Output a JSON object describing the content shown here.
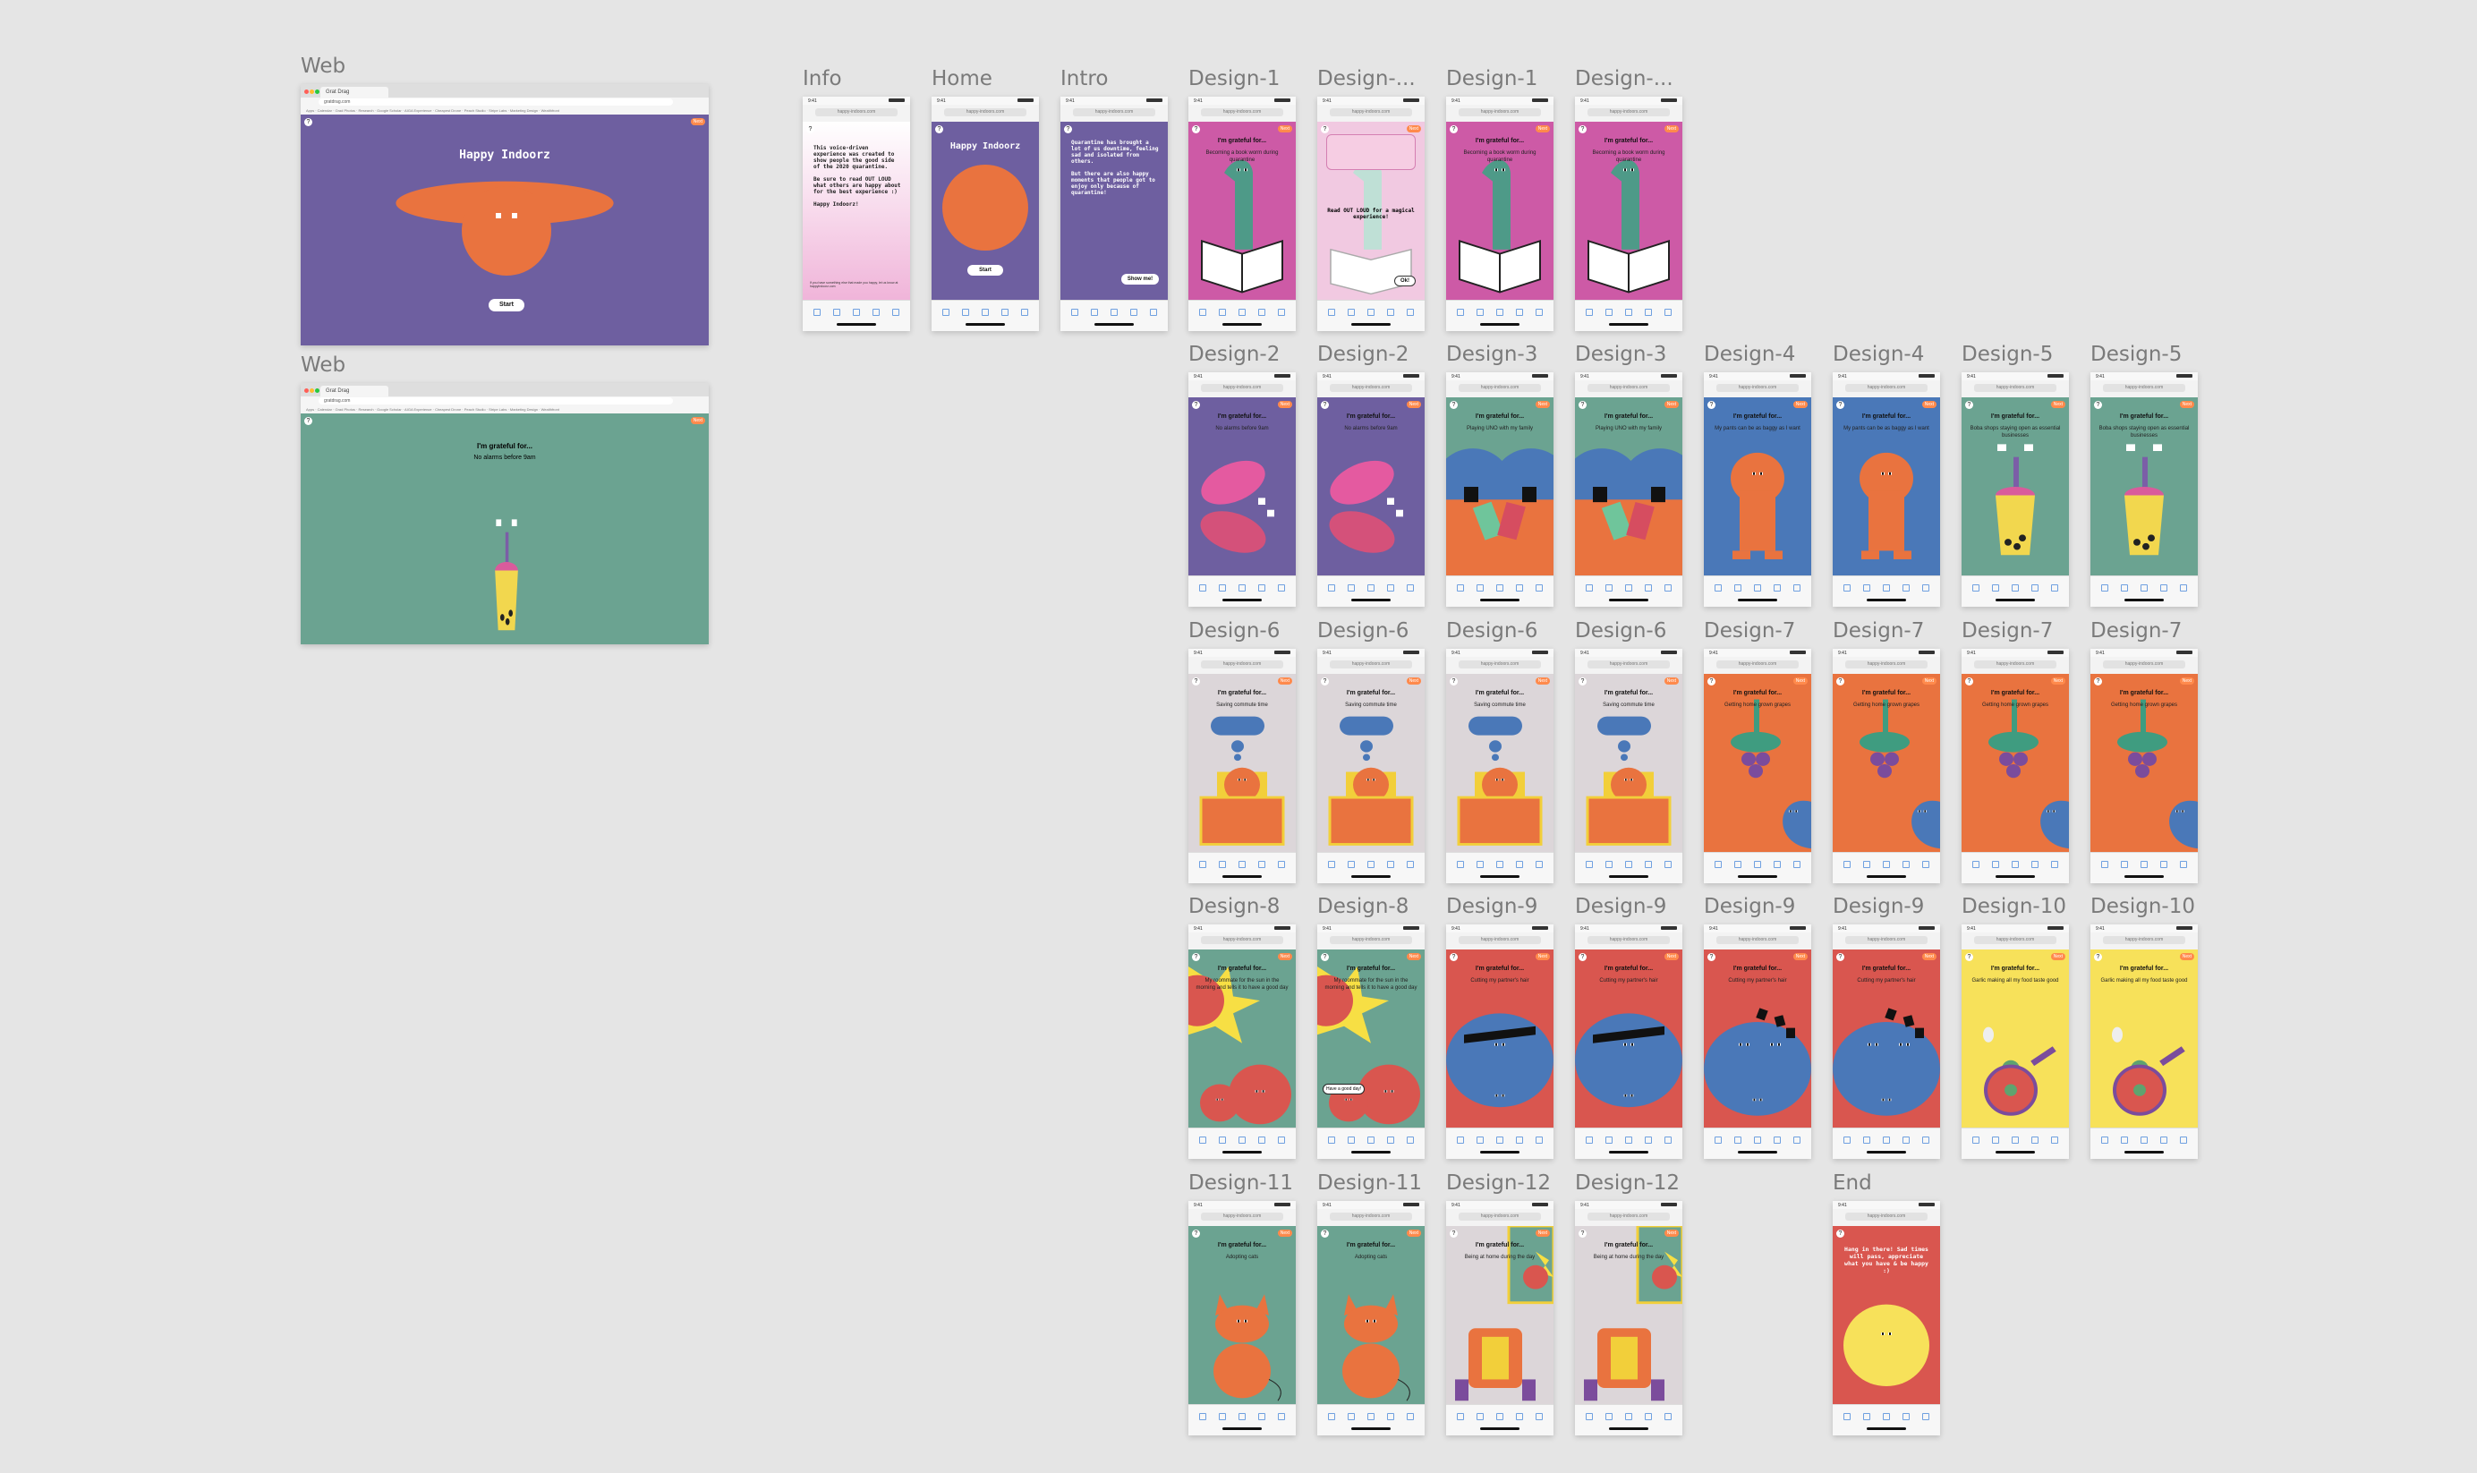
{
  "web_frames": [
    {
      "label": "Web",
      "tab": "Grat Drag",
      "url": "gratdrag.com",
      "bookmarks": "Apps · Calendar · Grad Photos · Research · Google Scholar · AIGA Experience · Cheapest Drone · Peach Studio · Stripe Labs · Marketing Design · Wealthfront"
    },
    {
      "label": "Web",
      "tab": "Grat Drag",
      "url": "gratdrag.com",
      "bookmarks": "Apps · Calendar · Grad Photos · Research · Google Scholar · AIGA Experience · Cheapest Drone · Peach Studio · Stripe Labs · Marketing Design · Wealthfront"
    }
  ],
  "web_home": {
    "title": "Happy Indoorz",
    "start": "Start",
    "next": "Next",
    "help": "?"
  },
  "web_design": {
    "grateful": "I'm grateful for...",
    "caption": "No alarms before 9am",
    "next": "Next",
    "help": "?"
  },
  "phone": {
    "time": "9:41",
    "url": "happy-indoors.com",
    "help": "?",
    "next": "Next"
  },
  "top_row": [
    {
      "label": "Info",
      "text": "This voice-driven experience was created to show people the good side of the 2020 quarantine.\n\nBe sure to read OUT LOUD what others are happy about for the best experience :)\n\nHappy Indoorz!",
      "footnote": "If you have something else that made you happy, let us know at happyindoorz.com"
    },
    {
      "label": "Home",
      "title": "Happy Indoorz",
      "button": "Start"
    },
    {
      "label": "Intro",
      "text": "Quarantine has brought a lot of us downtime, feeling sad and isolated from others.\n\nBut there are also happy moments that people got to enjoy only because of quarantine!",
      "button": "Show me!"
    },
    {
      "label": "Design-1",
      "grateful": "I'm grateful for...",
      "caption": "Becoming a book worm during quarantine"
    },
    {
      "label": "Design-...",
      "grateful": "I'm grateful for...",
      "caption": "Becoming a book worm during quarantine",
      "popup": "Read OUT LOUD for a magical experience!",
      "ok": "Ok!"
    },
    {
      "label": "Design-1",
      "grateful": "I'm grateful for...",
      "caption": "Becoming a book worm during quarantine"
    },
    {
      "label": "Design-...",
      "grateful": "I'm grateful for...",
      "caption": "Becoming a book worm during quarantine"
    }
  ],
  "grid": [
    [
      {
        "label": "Design-2",
        "caption": "No alarms before 9am"
      },
      {
        "label": "Design-2",
        "caption": "No alarms before 9am"
      },
      {
        "label": "Design-3",
        "caption": "Playing UNO with my family"
      },
      {
        "label": "Design-3",
        "caption": "Playing UNO with my family"
      },
      {
        "label": "Design-4",
        "caption": "My pants can be as baggy as I want"
      },
      {
        "label": "Design-4",
        "caption": "My pants can be as baggy as I want"
      },
      {
        "label": "Design-5",
        "caption": "Boba shops staying open as essential businesses"
      },
      {
        "label": "Design-5",
        "caption": "Boba shops staying open as essential businesses"
      }
    ],
    [
      {
        "label": "Design-6",
        "caption": "Saving commute time"
      },
      {
        "label": "Design-6",
        "caption": "Saving commute time"
      },
      {
        "label": "Design-6",
        "caption": "Saving commute time"
      },
      {
        "label": "Design-6",
        "caption": "Saving commute time"
      },
      {
        "label": "Design-7",
        "caption": "Getting home grown grapes"
      },
      {
        "label": "Design-7",
        "caption": "Getting home grown grapes"
      },
      {
        "label": "Design-7",
        "caption": "Getting home grown grapes"
      },
      {
        "label": "Design-7",
        "caption": "Getting home grown grapes"
      }
    ],
    [
      {
        "label": "Design-8",
        "caption": "My roommate for the sun in the morning and tells it to have a good day"
      },
      {
        "label": "Design-8",
        "caption": "My roommate for the sun in the morning and tells it to have a good day",
        "bubble": "Have a good day!"
      },
      {
        "label": "Design-9",
        "caption": "Cutting my partner's hair"
      },
      {
        "label": "Design-9",
        "caption": "Cutting my partner's hair"
      },
      {
        "label": "Design-9",
        "caption": "Cutting my partner's hair"
      },
      {
        "label": "Design-9",
        "caption": "Cutting my partner's hair"
      },
      {
        "label": "Design-10",
        "caption": "Garlic making all my food taste good"
      },
      {
        "label": "Design-10",
        "caption": "Garlic making all my food taste good"
      }
    ],
    [
      {
        "label": "Design-11",
        "caption": "Adopting cats"
      },
      {
        "label": "Design-11",
        "caption": "Adopting cats"
      },
      {
        "label": "Design-12",
        "caption": "Being at home during the day"
      },
      {
        "label": "Design-12",
        "caption": "Being at home during the day"
      }
    ]
  ],
  "end": {
    "label": "End",
    "text": "Hang in there! Sad times will pass, appreciate what you have & be happy :)"
  },
  "grateful": "I'm grateful for...",
  "colors": {
    "purple": "#6e5fa0",
    "teal": "#6ba391",
    "pink": "#cd5aa6",
    "blue": "#4a78b8",
    "orange": "#e9733f",
    "red": "#d9564f",
    "yellow": "#f7e15a",
    "canvas": "#e5e5e5"
  }
}
